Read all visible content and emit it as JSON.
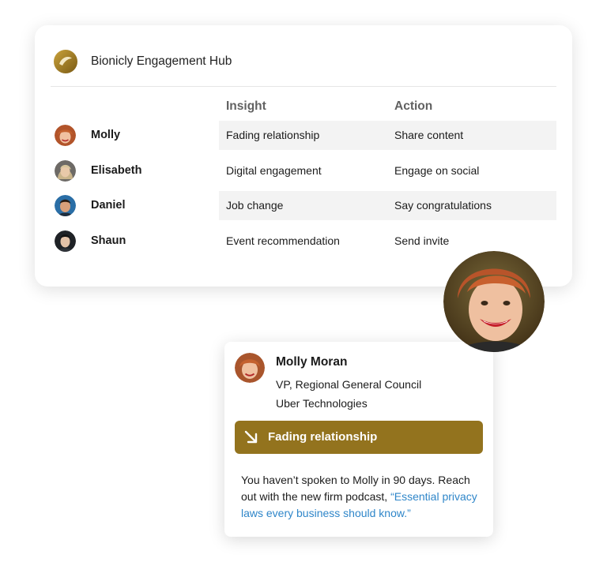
{
  "hub": {
    "title": "Bionicly Engagement Hub",
    "columns": {
      "insight": "Insight",
      "action": "Action"
    },
    "contacts": [
      {
        "name": "Molly",
        "insight": "Fading relationship",
        "action": "Share content",
        "avatar": "molly-avatar"
      },
      {
        "name": "Elisabeth",
        "insight": "Digital engagement",
        "action": "Engage on social",
        "avatar": "elisabeth-avatar"
      },
      {
        "name": "Daniel",
        "insight": "Job change",
        "action": "Say congratulations",
        "avatar": "daniel-avatar"
      },
      {
        "name": "Shaun",
        "insight": "Event recommendation",
        "action": "Send invite",
        "avatar": "shaun-avatar"
      }
    ]
  },
  "detail": {
    "name": "Molly Moran",
    "role": "VP, Regional General Council",
    "company": "Uber Technologies",
    "alert": {
      "label": "Fading relationship",
      "icon": "arrow-down-right-icon"
    },
    "message_prefix": "You haven’t spoken to Molly in 90 days. Reach out with the new firm podcast, ",
    "message_link": "“Essential privacy laws every business should know.”"
  },
  "colors": {
    "accent_gold": "#93731e",
    "link_blue": "#2f86c9",
    "row_shade": "#f3f3f3",
    "text_primary": "#1b1b1b",
    "column_header": "#616161"
  },
  "icons": {
    "logo": "bionicly-logo-icon"
  }
}
